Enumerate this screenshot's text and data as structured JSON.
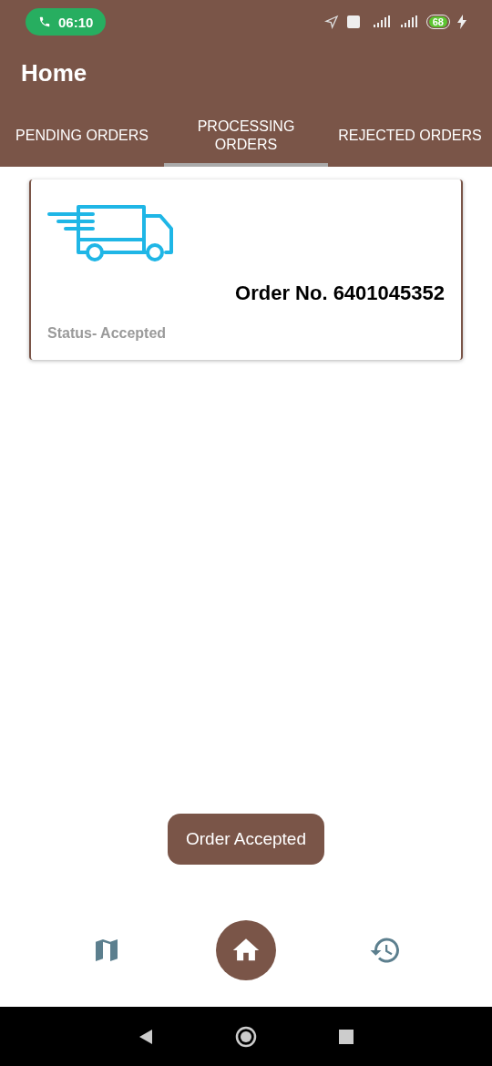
{
  "status_bar": {
    "time": "06:10",
    "battery": "68"
  },
  "app_bar": {
    "title": "Home"
  },
  "tabs": [
    {
      "label": "PENDING ORDERS",
      "selected": false
    },
    {
      "label": "PROCESSING ORDERS",
      "selected": true
    },
    {
      "label": "REJECTED ORDERS",
      "selected": false
    }
  ],
  "orders": [
    {
      "order_no": "Order No. 6401045352",
      "status": "Status- Accepted"
    }
  ],
  "toast": "Order Accepted",
  "bottom_nav": [
    {
      "kind": "map",
      "selected": false
    },
    {
      "kind": "home",
      "selected": true
    },
    {
      "kind": "history",
      "selected": false
    }
  ]
}
